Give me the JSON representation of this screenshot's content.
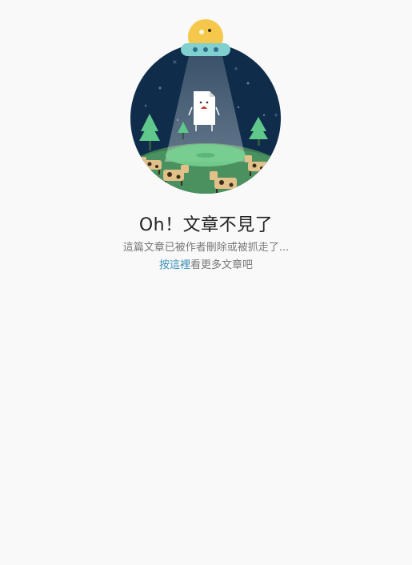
{
  "error": {
    "title": "Oh！文章不見了",
    "subtitle": "這篇文章已被作者刪除或被抓走了...",
    "link_text": "按這裡",
    "after_link_text": "看更多文章吧"
  },
  "illustration": {
    "icon": "ufo-abducting-document-illustration",
    "colors": {
      "night_sky": "#0f2d4a",
      "ground": "#4a9160",
      "ufo_body": "#7fd0cf",
      "ufo_dome": "#f5c84c",
      "tree": "#5fc88a",
      "document": "#ffffff"
    }
  }
}
